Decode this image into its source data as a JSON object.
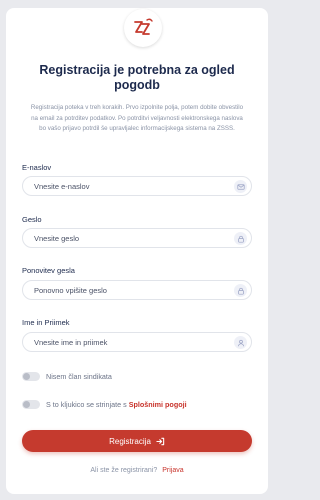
{
  "brand": {
    "accent_color": "#c53a2e",
    "logo_icon": "zzss-logo-icon"
  },
  "header": {
    "title": "Registracija je potrebna za ogled pogodb",
    "description": "Registracija poteka v treh korakih. Prvo izpolnite polja, potem dobite obvestilo na email za potrditev podatkov. Po potrditvi veljavnosti elektronskega naslova bo vašo prijavo potrdil še upravljalec informacijskega sistema na ZSSS."
  },
  "form": {
    "email": {
      "label": "E-naslov",
      "placeholder": "Vnesite e-naslov",
      "icon": "envelope-icon"
    },
    "password": {
      "label": "Geslo",
      "placeholder": "Vnesite geslo",
      "icon": "lock-icon"
    },
    "password_repeat": {
      "label": "Ponovitev gesla",
      "placeholder": "Ponovno vpišite geslo",
      "icon": "lock-icon"
    },
    "name": {
      "label": "Ime in Priimek",
      "placeholder": "Vnesite ime in priimek",
      "icon": "user-icon"
    }
  },
  "toggles": {
    "non_member": {
      "label": "Nisem član sindikata"
    },
    "terms": {
      "prefix": "S to kljukico se strinjate s",
      "link": "Splošnimi pogoji"
    }
  },
  "actions": {
    "register_label": "Registracija",
    "register_icon": "sign-in-icon",
    "login_prompt": "Ali ste že registrirani?",
    "login_link": "Prijava"
  }
}
